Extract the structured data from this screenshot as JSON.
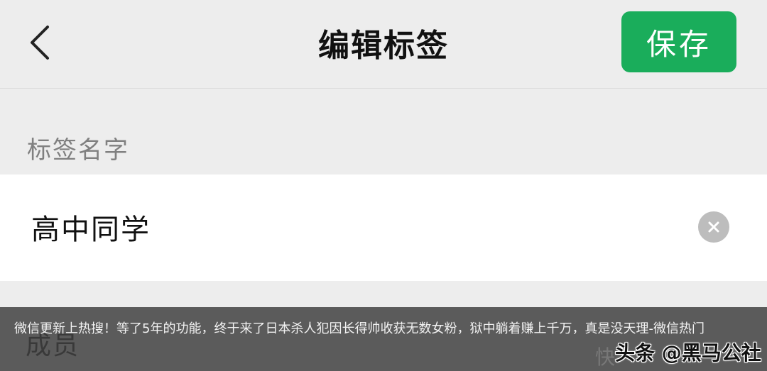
{
  "navbar": {
    "title": "编辑标签",
    "save_label": "保存",
    "back_icon": "chevron-left-icon"
  },
  "colors": {
    "background": "#ededed",
    "accent": "#1aad5b",
    "input_bg": "#ffffff"
  },
  "form": {
    "section_label": "标签名字",
    "tag_name_value": "高中同学",
    "clear_icon": "clear-circle-icon"
  },
  "members": {
    "label": "成员"
  },
  "caption": {
    "text": "微信更新上热搜！等了5年的功能，终于来了日本杀人犯因长得帅收获无数女粉，狱中躺着赚上千万，真是没天理-微信热门"
  },
  "watermark": {
    "main": "头条 @黑马公社",
    "faint": "快"
  }
}
